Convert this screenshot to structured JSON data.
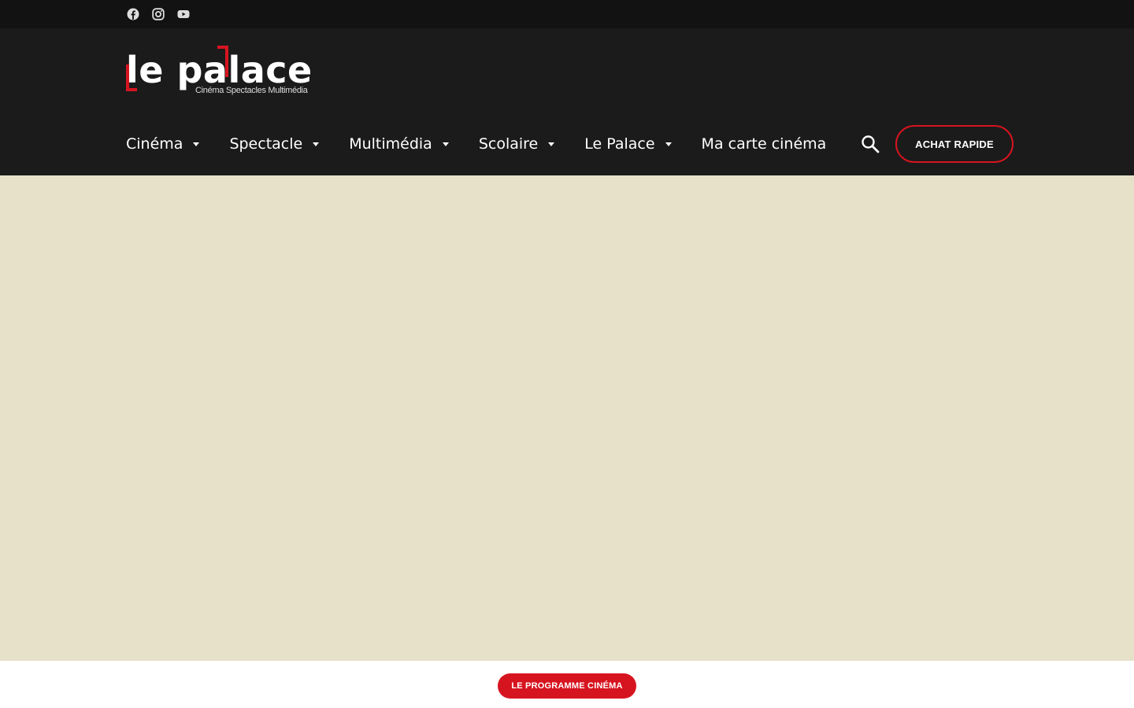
{
  "social": {
    "items": [
      {
        "icon": "facebook-icon"
      },
      {
        "icon": "instagram-icon"
      },
      {
        "icon": "youtube-icon"
      }
    ]
  },
  "logo": {
    "text": "le palace",
    "tagline": "Cinéma Spectacles Multimédia"
  },
  "nav": {
    "items": [
      {
        "label": "Cinéma",
        "has_dropdown": true
      },
      {
        "label": "Spectacle",
        "has_dropdown": true
      },
      {
        "label": "Multimédia",
        "has_dropdown": true
      },
      {
        "label": "Scolaire",
        "has_dropdown": true
      },
      {
        "label": "Le Palace",
        "has_dropdown": true
      },
      {
        "label": "Ma carte cinéma",
        "has_dropdown": false
      }
    ],
    "search_icon": "search-icon",
    "cta_label": "ACHAT RAPIDE"
  },
  "hero": {
    "background_color": "#e8e1ca"
  },
  "footer_bar": {
    "programme_label": "LE PROGRAMME CINÉMA"
  },
  "colors": {
    "accent": "#d6141f",
    "header_bg": "#1b1b1b",
    "topbar_bg": "#121212",
    "hero_bg": "#e8e1ca"
  }
}
